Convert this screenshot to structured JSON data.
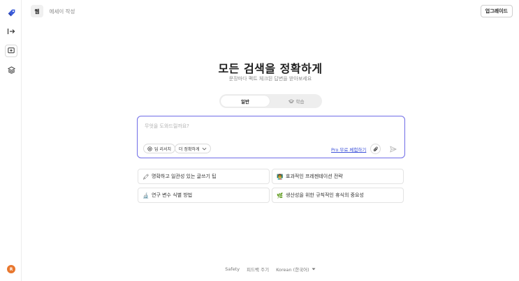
{
  "sidebar": {
    "logo_icon": "rocket-logo-icon",
    "items": [
      {
        "icon": "expand-sidebar-icon",
        "glyph": "→"
      },
      {
        "icon": "new-chat-icon",
        "glyph": "+"
      },
      {
        "icon": "layers-icon",
        "glyph": "◈"
      }
    ],
    "avatar_letter": "R",
    "avatar_color": "#e8772e"
  },
  "header": {
    "tabs": [
      {
        "label": "웹",
        "active": true
      },
      {
        "label": "에세이 작성",
        "active": false
      }
    ],
    "upgrade_label": "업그레이드"
  },
  "main": {
    "title": "모든 검색을 정확하게",
    "subtitle": "문장마다 팩트 체크된 답변을 받아보세요",
    "modes": [
      {
        "label": "일반",
        "active": true,
        "icon": ""
      },
      {
        "label": "학습",
        "active": false,
        "icon": "graduation-cap-icon"
      }
    ]
  },
  "search": {
    "placeholder": "무엇을 도와드릴까요?",
    "value": "",
    "deep_research_label": "딥 리서치",
    "precision_label": "더 정확하게",
    "pro_trial_label": "Pro 무료 체험하기",
    "accent_color": "#6f6ce6"
  },
  "suggestions": [
    {
      "emoji": "🖍",
      "label": "명확하고 일관성 있는 글쓰기 팁"
    },
    {
      "emoji": "👨‍🏫",
      "label": "효과적인 프레젠테이션 전략"
    },
    {
      "emoji": "🔬",
      "label": "연구 변수 식별 방법"
    },
    {
      "emoji": "🌿",
      "label": "생산성을 위한 규칙적인 휴식의 중요성"
    }
  ],
  "footer": {
    "safety": "Safety",
    "feedback": "피드백 주기",
    "language": "Korean (한국어)"
  }
}
